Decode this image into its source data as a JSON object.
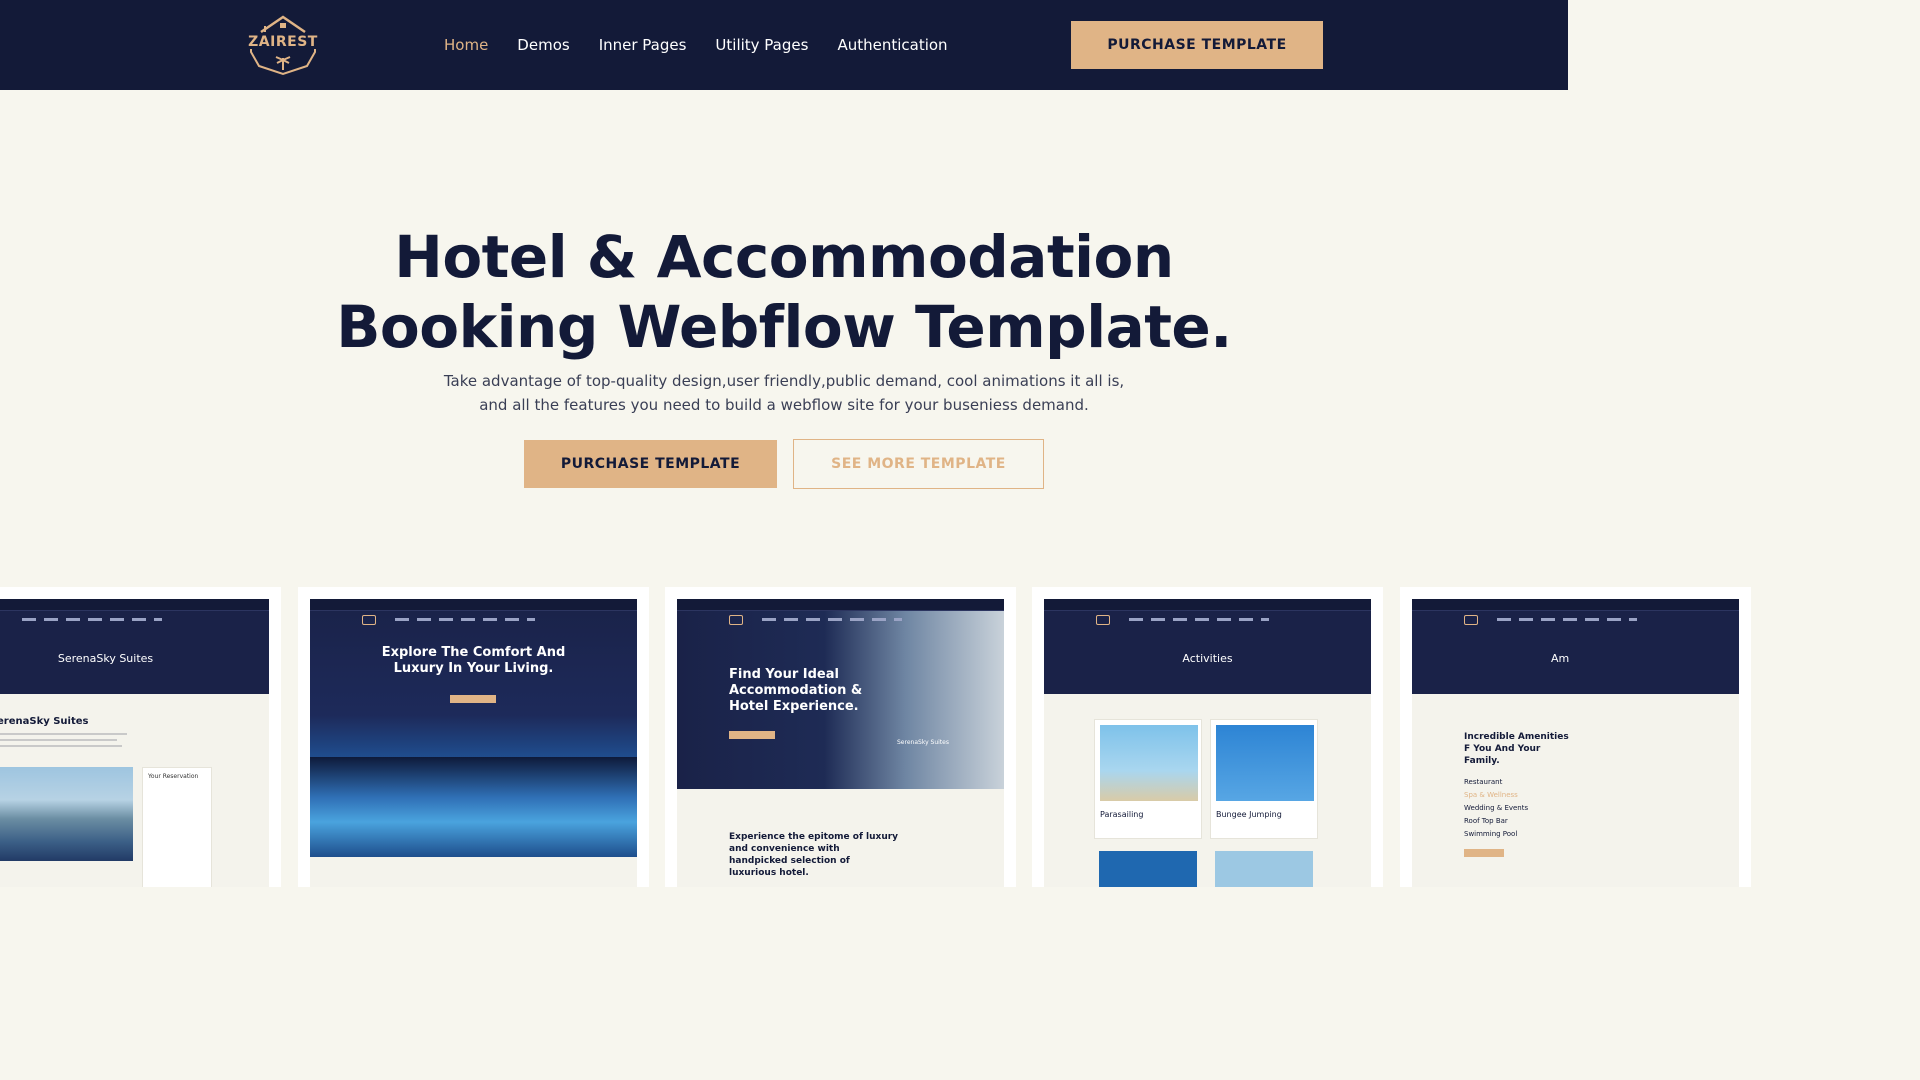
{
  "brand": {
    "name": "ZAIREST",
    "accent": "#e0b486",
    "navy": "#131a38"
  },
  "nav": {
    "items": [
      {
        "label": "Home",
        "active": true
      },
      {
        "label": "Demos",
        "active": false
      },
      {
        "label": "Inner Pages",
        "active": false
      },
      {
        "label": "Utility Pages",
        "active": false
      },
      {
        "label": "Authentication",
        "active": false
      }
    ],
    "cta": "PURCHASE TEMPLATE"
  },
  "hero": {
    "title_line1": "Hotel & Accommodation",
    "title_line2": "Booking Webflow Template.",
    "subtitle_line1": "Take advantage of top-quality design,user friendly,public demand, cool animations it all is,",
    "subtitle_line2": "and all the features you need to build a webflow site for your buseniess demand.",
    "primary_button": "PURCHASE TEMPLATE",
    "secondary_button": "SEE MORE TEMPLATE"
  },
  "previews": [
    {
      "banner": "SerenaSky Suites",
      "heading": "erenaSky Suites",
      "side_title": "Your Reservation"
    },
    {
      "banner": "Explore The Comfort And Luxury In Your Living."
    },
    {
      "banner": "Find Your Ideal Accommodation & Hotel Experience.",
      "overlay": "SerenaSky Suites",
      "body": "Experience the epitome of luxury and convenience with handpicked selection of luxurious hotel."
    },
    {
      "banner": "Activities",
      "items": [
        "Parasailing",
        "Bungee Jumping"
      ]
    },
    {
      "banner": "Am",
      "heading": "Incredible Amenities F You And Your Family.",
      "list": [
        "Restaurant",
        "Spa & Wellness",
        "Wedding & Events",
        "Roof Top Bar",
        "Swimming Pool"
      ]
    }
  ]
}
